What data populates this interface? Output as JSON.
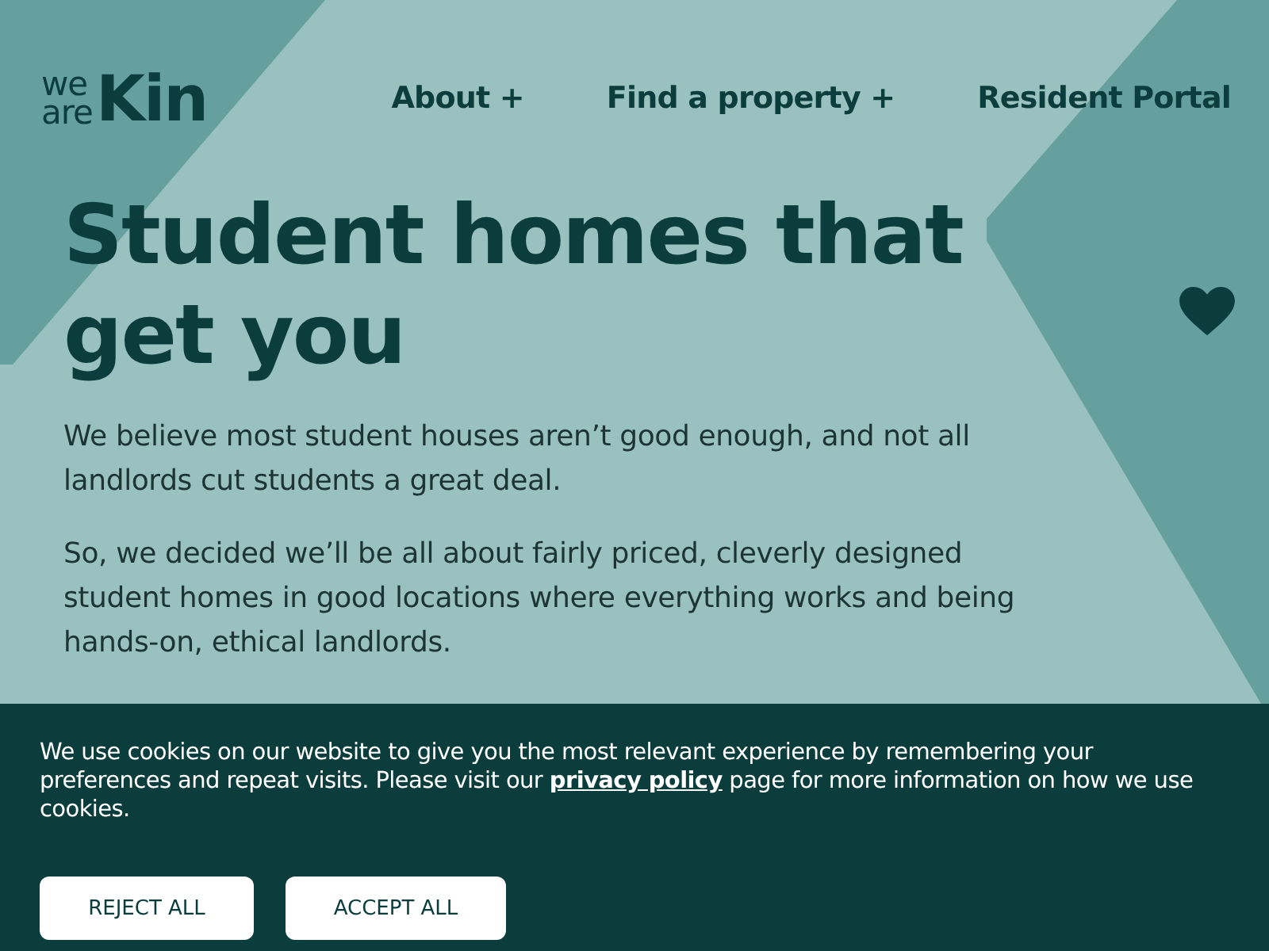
{
  "logo": {
    "line1": "we",
    "line2": "are",
    "main": "Kin"
  },
  "nav": [
    {
      "label": "About +"
    },
    {
      "label": "Find a property +"
    },
    {
      "label": "Resident Portal"
    }
  ],
  "hero": {
    "heading": "Student homes that get you",
    "paragraphs": [
      "We believe most student houses aren’t good enough, and not all landlords cut students a great deal.",
      "So, we decided we’ll be all about fairly priced, cleverly designed student homes in good locations where everything works and being hands-on, ethical landlords."
    ]
  },
  "cookie_banner": {
    "text_before": "We use cookies on our website to give you the most relevant experience by remembering your preferences and repeat visits. Please visit our ",
    "link": "privacy policy",
    "text_after": " page for more information on how we use cookies.",
    "buttons": [
      "REJECT ALL",
      "ACCEPT ALL"
    ]
  }
}
